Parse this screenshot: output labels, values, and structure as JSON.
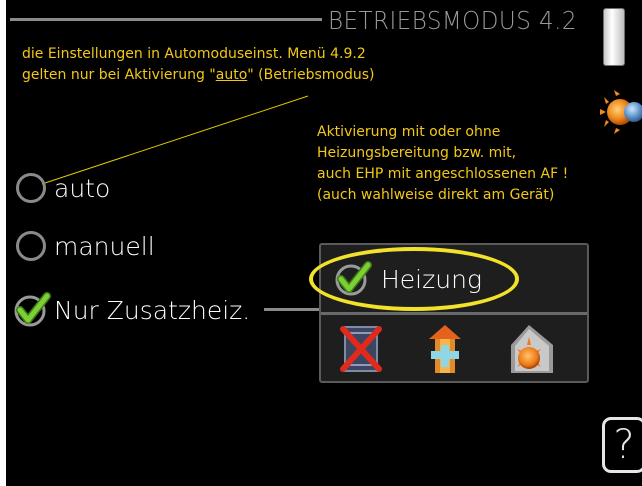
{
  "header": {
    "title": "BETRIEBSMODUS 4.2"
  },
  "notes": {
    "top_line1": "die Einstellungen in Automoduseinst. Menü 4.9.2",
    "top_line2_before": "gelten nur bei Aktivierung \"",
    "top_line2_link": "auto",
    "top_line2_after": "\" (Betriebsmodus)",
    "right_lines": [
      "Aktivierung mit oder ohne",
      "Heizungsbereitung bzw. mit,",
      "auch EHP mit angeschlossenen AF !",
      "(auch wahlweise direkt am Gerät)"
    ]
  },
  "options": [
    {
      "label": "auto",
      "selected": false
    },
    {
      "label": "manuell",
      "selected": false
    },
    {
      "label": "Nur Zusatzheiz.",
      "selected": true
    }
  ],
  "popup": {
    "heizung_label": "Heizung",
    "heizung_checked": true,
    "icons": [
      "heating-off-icon",
      "additional-heat-icon",
      "pool-heating-icon"
    ]
  },
  "help": {
    "label": "?"
  },
  "colors": {
    "background": "#000000",
    "annotation_text": "#f2c818",
    "highlight": "#f2e22a",
    "check_green": "#6ab82e",
    "frame_gray": "#8a8a8a"
  }
}
